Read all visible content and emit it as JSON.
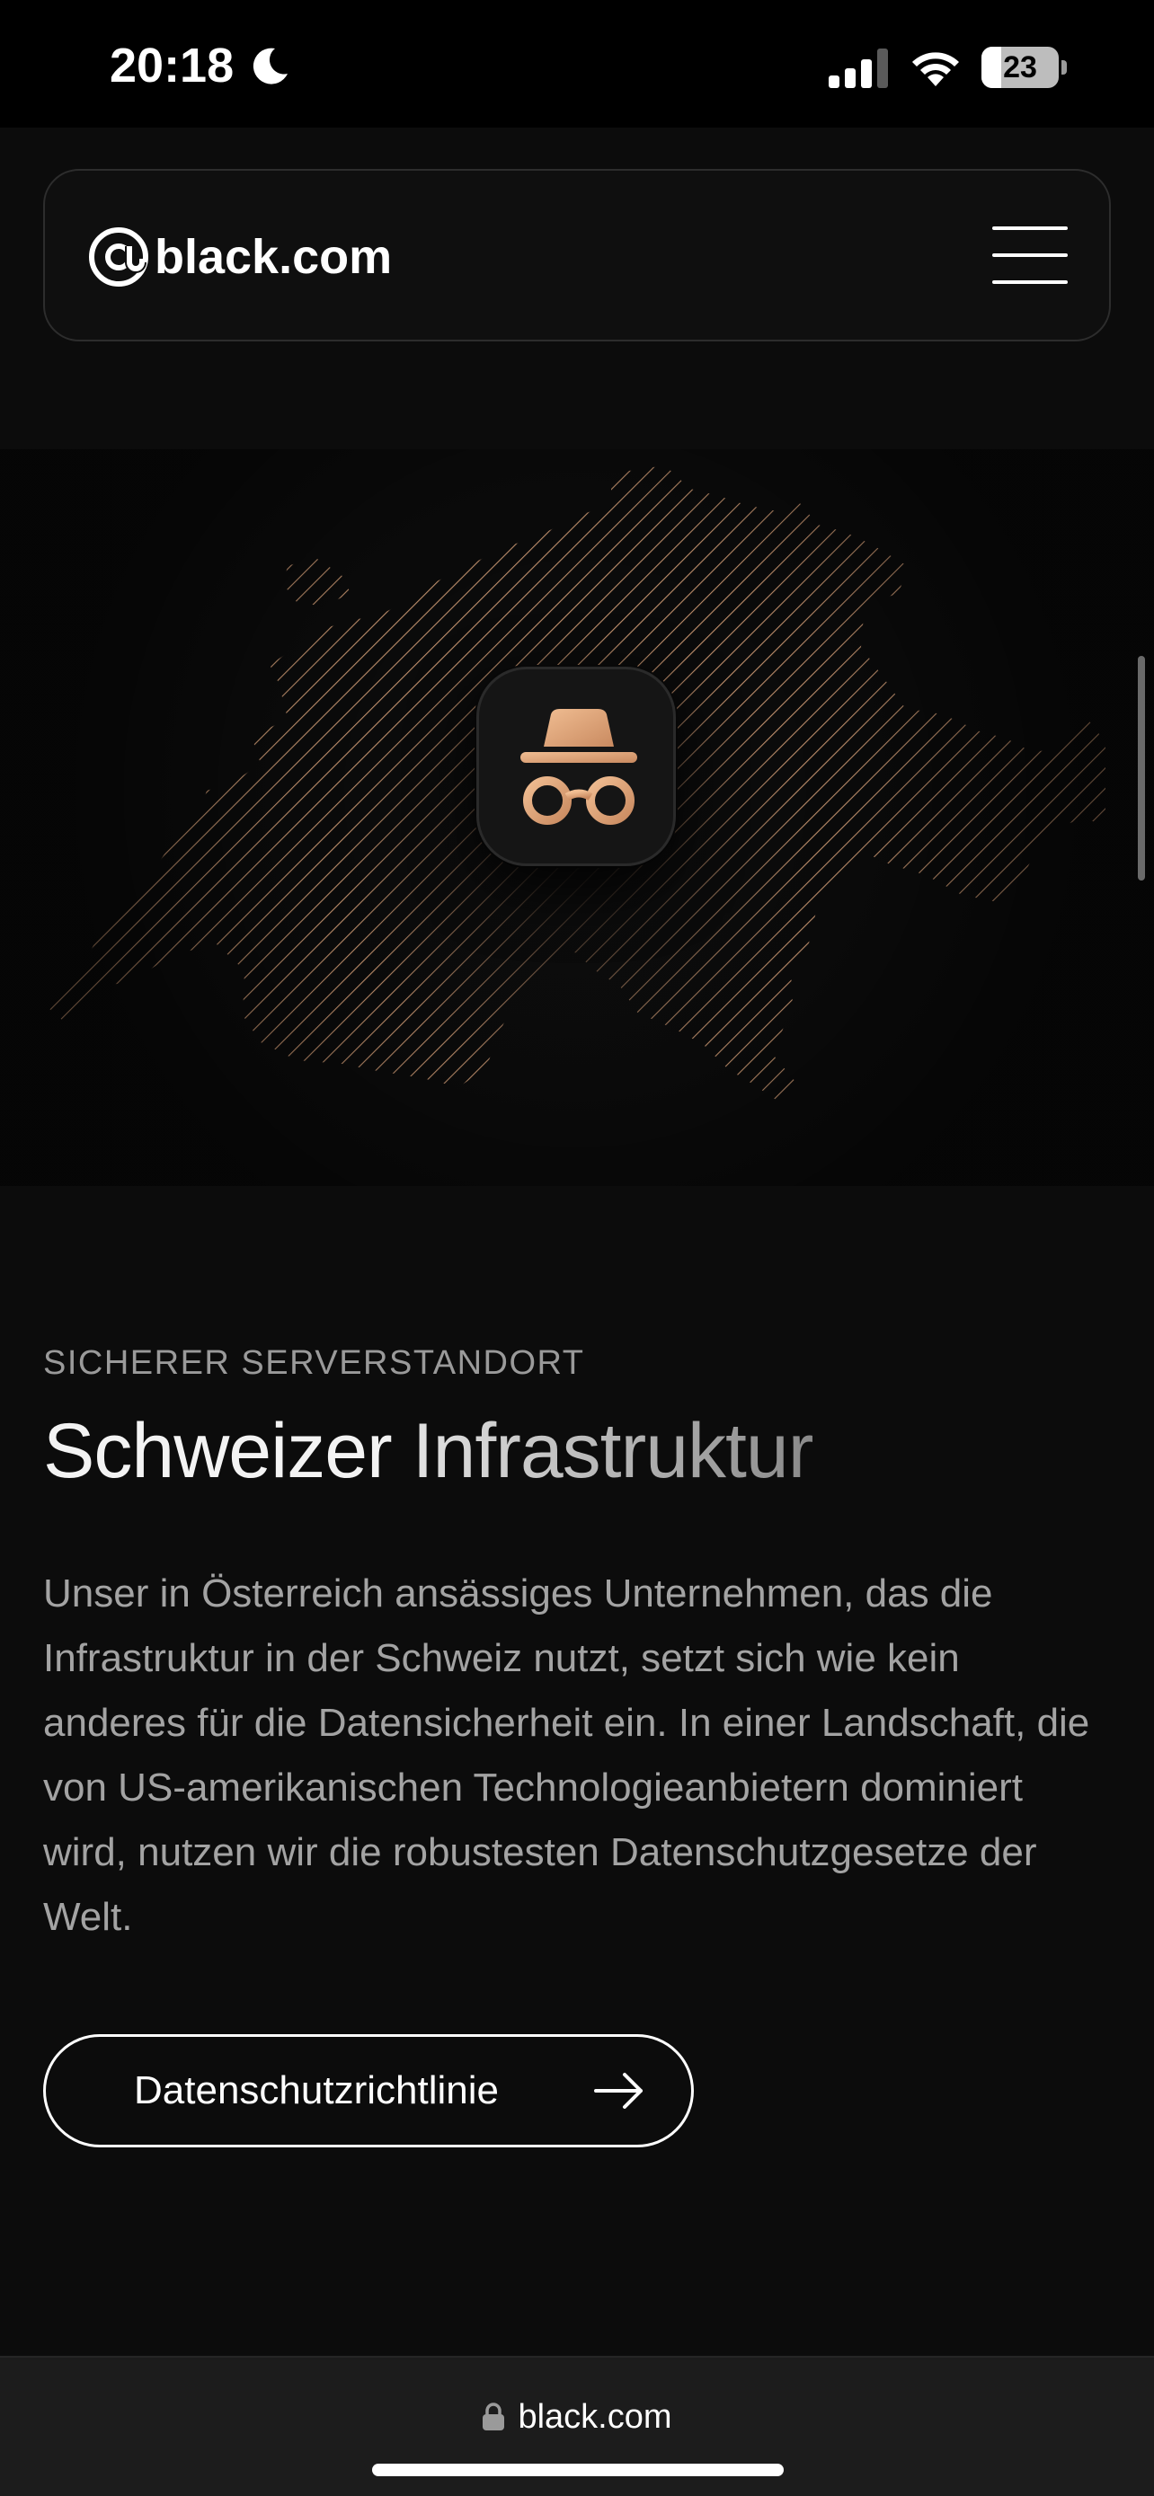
{
  "status_bar": {
    "time": "20:18",
    "focus_icon": "moon-icon",
    "signal_icon": "cellular-signal-icon",
    "wifi_icon": "wifi-icon",
    "battery_level": "23"
  },
  "header": {
    "logo_icon": "at-sign-icon",
    "logo_text": "black.com",
    "menu_icon": "hamburger-menu-icon"
  },
  "hero": {
    "map_description_icon": "switzerland-map",
    "center_icon": "incognito-spy-icon",
    "accent_color": "#d8a27a"
  },
  "section": {
    "eyebrow": "SICHERER SERVERSTANDORT",
    "headline_part1": "Schweizer ",
    "headline_part2": "Infrastruktur",
    "body": "Unser in Österreich ansässiges Unternehmen, das die Infrastruktur in der Schweiz nutzt, setzt sich wie kein anderes für die Datensicherheit ein. In einer Landschaft, die von US-amerikanischen Technologieanbietern dominiert wird, nutzen wir die robustesten Datenschutzgesetze der Welt.",
    "cta_label": "Datenschutzrichtlinie",
    "cta_icon": "arrow-right-icon"
  },
  "browser": {
    "lock_icon": "lock-icon",
    "url": "black.com"
  }
}
